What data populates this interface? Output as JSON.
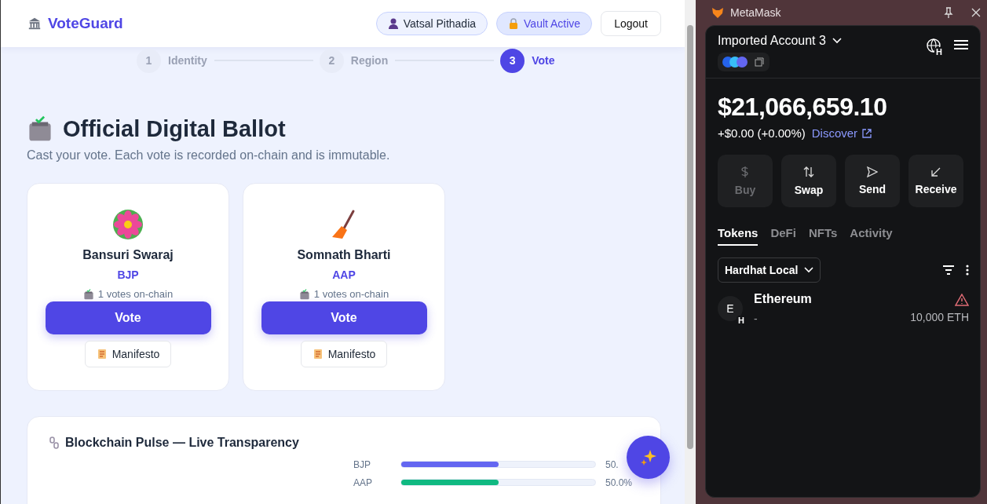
{
  "app": {
    "brand": "VoteGuard",
    "user": "Vatsal Pithadia",
    "vault": "Vault Active",
    "logout": "Logout"
  },
  "steps": [
    {
      "number": "1",
      "label": "Identity",
      "selected": false
    },
    {
      "number": "2",
      "label": "Region",
      "selected": false
    },
    {
      "number": "3",
      "label": "Vote",
      "selected": true
    }
  ],
  "ballot": {
    "title": "Official Digital Ballot",
    "subtitle": "Cast your vote. Each vote is recorded on-chain and is immutable."
  },
  "candidates": [
    {
      "kind": "lotus",
      "name": "Bansuri Swaraj",
      "party": "BJP",
      "votes": "1 votes on-chain",
      "vote_button": "Vote",
      "manifesto": "Manifesto"
    },
    {
      "kind": "broom",
      "name": "Somnath Bharti",
      "party": "AAP",
      "votes": "1 votes on-chain",
      "vote_button": "Vote",
      "manifesto": "Manifesto"
    }
  ],
  "pulse": {
    "title": "Blockchain Pulse — Live Transparency",
    "bars": [
      {
        "party": "BJP",
        "level": 0.5,
        "color": "#6366f1",
        "reading": "50."
      },
      {
        "party": "AAP",
        "level": 0.5,
        "color": "#10b981",
        "reading": "50.0%"
      }
    ]
  },
  "wallet": {
    "title": "MetaMask",
    "account": "Imported Account 3",
    "network_badge": "H",
    "balance": "$21,066,659.10",
    "change": "+$0.00 (+0.00%)",
    "discover": "Discover",
    "actions": [
      {
        "kind": "buy",
        "label": "Buy",
        "disabled": true
      },
      {
        "kind": "swap",
        "label": "Swap",
        "disabled": false
      },
      {
        "kind": "send",
        "label": "Send",
        "disabled": false
      },
      {
        "kind": "receive",
        "label": "Receive",
        "disabled": false
      }
    ],
    "tabs": [
      {
        "label": "Tokens",
        "selected": true
      },
      {
        "label": "DeFi",
        "selected": false
      },
      {
        "label": "NFTs",
        "selected": false
      },
      {
        "label": "Activity",
        "selected": false
      }
    ],
    "network": "Hardhat Local",
    "tokens": [
      {
        "avatar": "E",
        "badge": "H",
        "name": "Ethereum",
        "value": "-",
        "amount": "10,000 ETH",
        "warning": true
      }
    ]
  }
}
